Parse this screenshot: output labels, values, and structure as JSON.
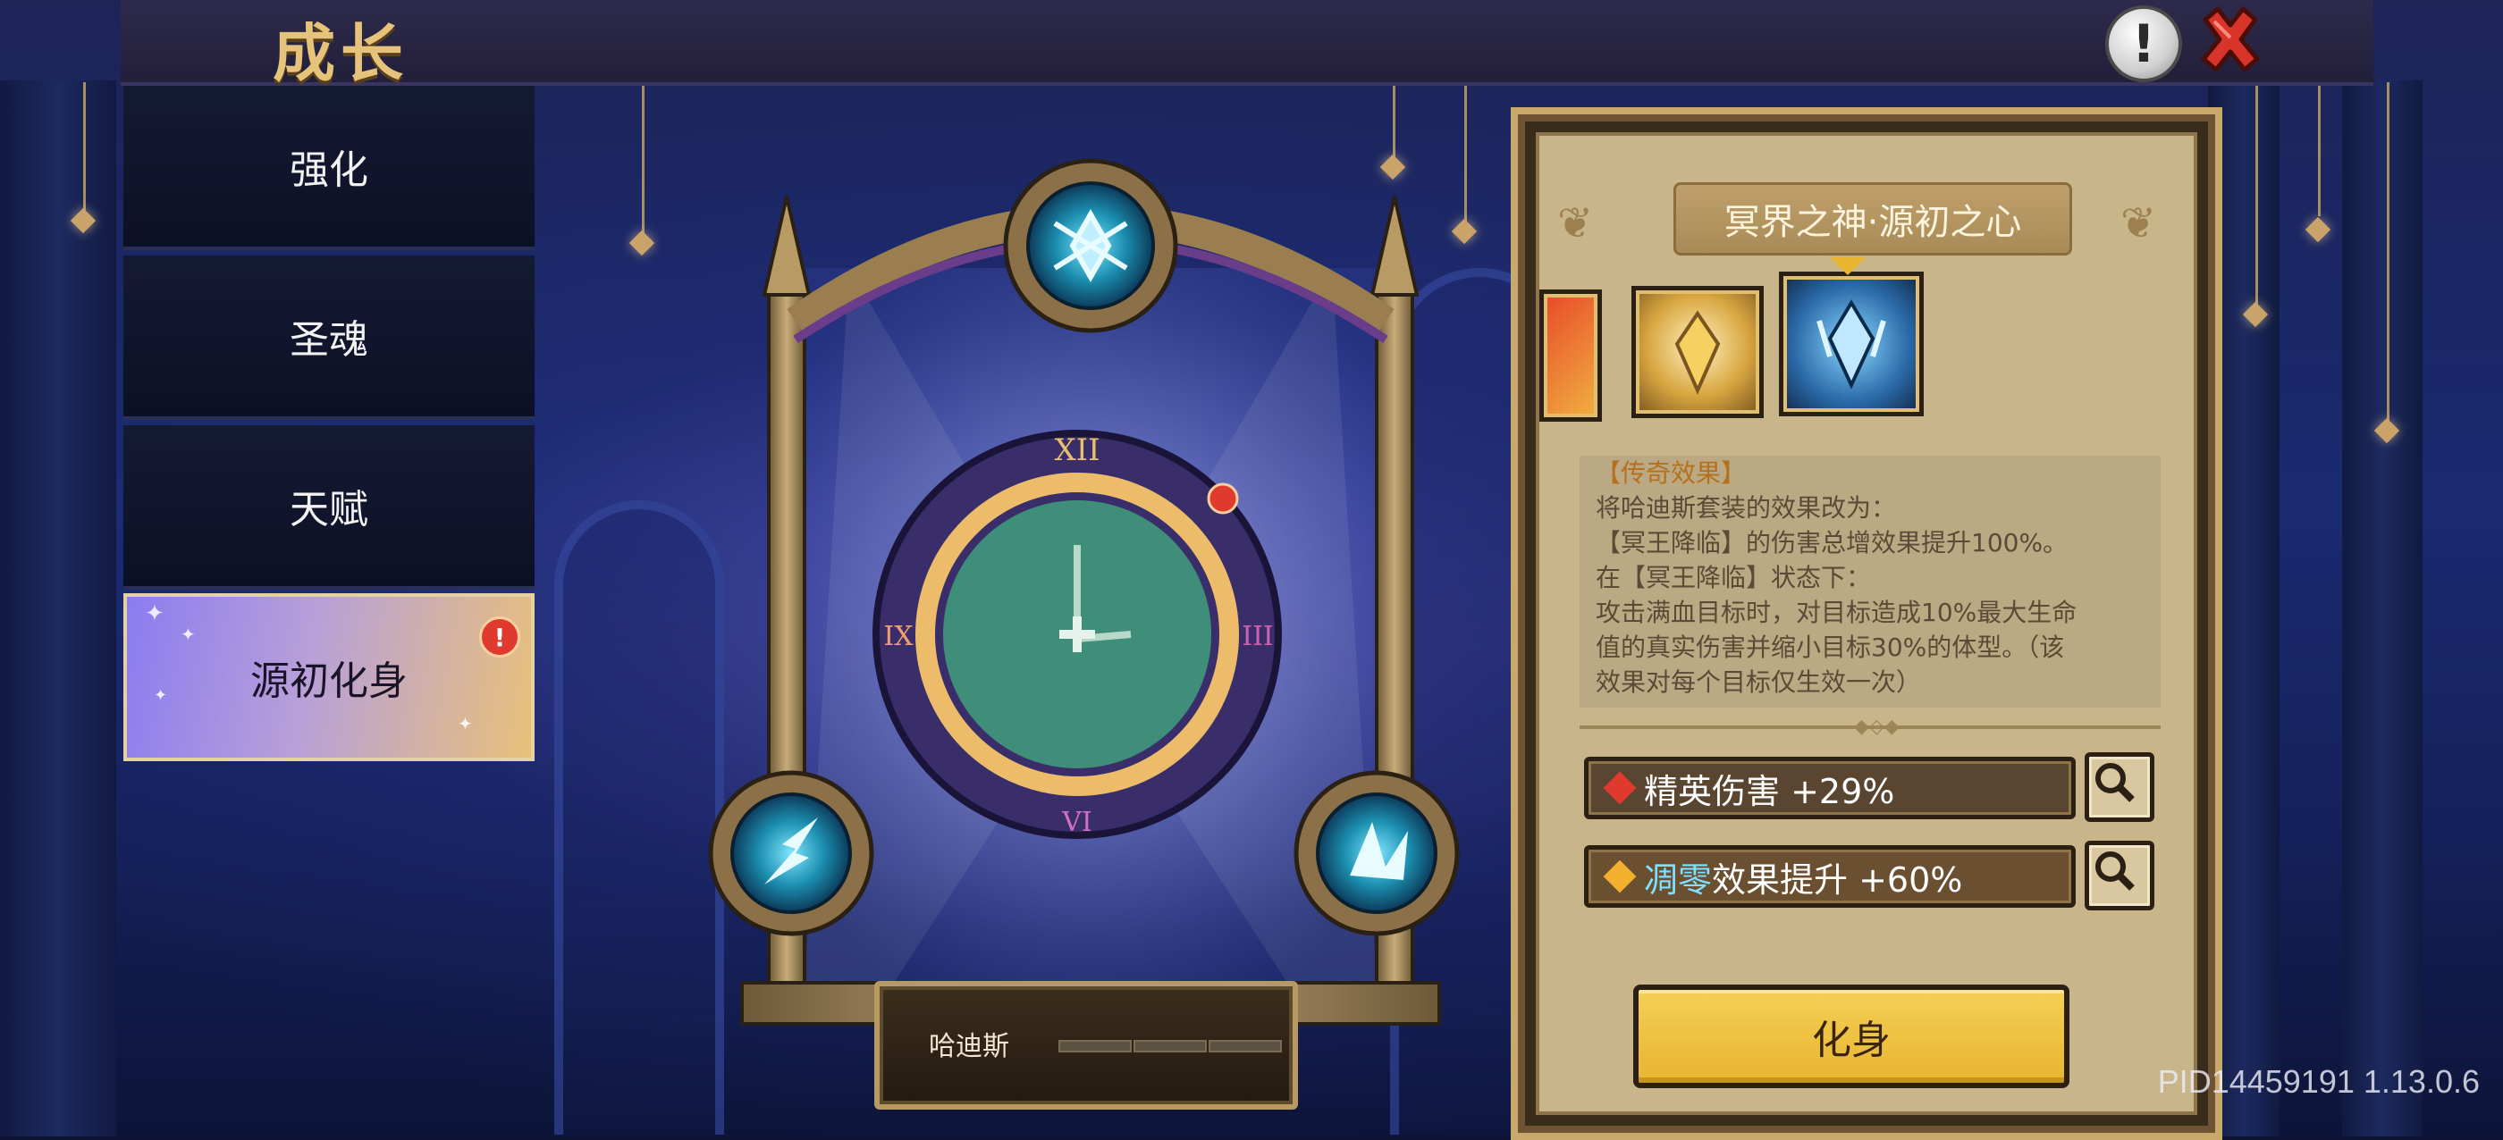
{
  "header": {
    "title": "成长"
  },
  "icons": {
    "help": "exclamation-icon",
    "close": "close-x-icon",
    "zoom": "magnifier-icon"
  },
  "sidebar": {
    "items": [
      {
        "label": "强化",
        "active": false
      },
      {
        "label": "圣魂",
        "active": false
      },
      {
        "label": "天赋",
        "active": false
      },
      {
        "label": "源初化身",
        "active": true,
        "alert": true
      }
    ]
  },
  "center": {
    "clock_numerals": {
      "top": "XII",
      "left": "IX",
      "right": "III",
      "bottom": "VI"
    },
    "character_name": "哈迪斯"
  },
  "panel": {
    "set_title": "冥界之神·源初之心",
    "effect_title": "【传奇效果】",
    "effect_lines": [
      "将哈迪斯套装的效果改为：",
      "【冥王降临】的伤害总增效果提升100%。",
      "在【冥王降临】状态下：",
      "攻击满血目标时，对目标造成10%最大生命",
      "值的真实伤害并缩小目标30%的体型。（该",
      "效果对每个目标仅生效一次）"
    ],
    "stats": [
      {
        "label": "精英伤害 +29%",
        "gem_color": "#e03a2e"
      },
      {
        "highlight": "凋零",
        "label": "效果提升 +60%",
        "gem_color": "#f2b02e"
      }
    ],
    "avatar_button": "化身"
  },
  "version": "PID14459191 1.13.0.6",
  "colors": {
    "accent_gold": "#e6c37a",
    "button_yellow": "#f4cf55",
    "panel_bg": "#c9b58a"
  }
}
